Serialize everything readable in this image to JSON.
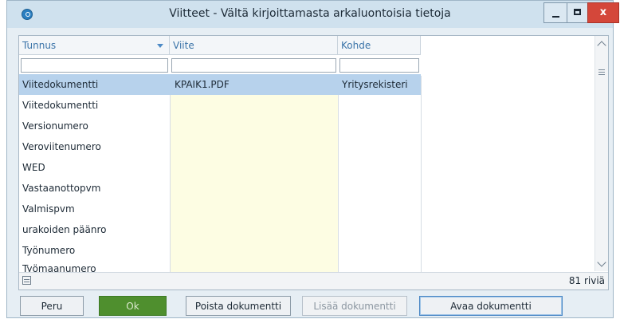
{
  "window": {
    "title": "Viitteet - Vältä kirjoittamasta arkaluontoisia tietoja",
    "close_label": "x"
  },
  "table": {
    "columns": [
      "Tunnus",
      "Viite",
      "Kohde"
    ],
    "filters": [
      "",
      "",
      ""
    ],
    "rows": [
      {
        "tunnus": "Viitedokumentti",
        "viite": "KPAIK1.PDF",
        "kohde": "Yritysrekisteri",
        "selected": true
      },
      {
        "tunnus": "Viitedokumentti",
        "viite": "",
        "kohde": ""
      },
      {
        "tunnus": "Versionumero",
        "viite": "",
        "kohde": ""
      },
      {
        "tunnus": "Veroviitenumero",
        "viite": "",
        "kohde": ""
      },
      {
        "tunnus": "WED",
        "viite": "",
        "kohde": ""
      },
      {
        "tunnus": "Vastaanottopvm",
        "viite": "",
        "kohde": ""
      },
      {
        "tunnus": "Valmispvm",
        "viite": "",
        "kohde": ""
      },
      {
        "tunnus": "urakoiden päänro",
        "viite": "",
        "kohde": ""
      },
      {
        "tunnus": "Työnumero",
        "viite": "",
        "kohde": ""
      },
      {
        "tunnus": "Työmaanumero",
        "viite": "",
        "kohde": ""
      }
    ],
    "row_count": "81 riviä"
  },
  "buttons": {
    "peru": "Peru",
    "ok": "Ok",
    "poista": "Poista dokumentti",
    "lisaa": "Lisää dokumentti",
    "avaa": "Avaa dokumentti"
  },
  "colors": {
    "selected_row": "#b7d2ec",
    "viite_column_bg": "#fdfde3",
    "ok_button": "#4f8f2e",
    "header_text": "#3a73a8",
    "close_button": "#d4473a"
  },
  "icons": [
    "app-icon",
    "sort-down-icon",
    "minimize-icon",
    "maximize-icon",
    "close-icon",
    "scroll-up-icon",
    "scroll-down-icon",
    "column-chooser-icon"
  ]
}
